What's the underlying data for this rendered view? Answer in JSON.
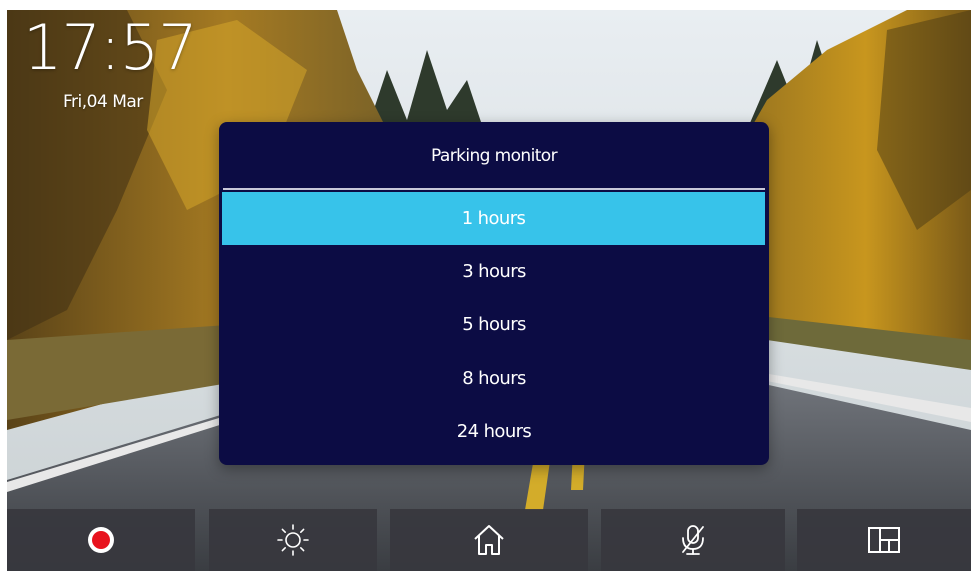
{
  "status": {
    "time": "17:57",
    "date": "Fri,04 Mar"
  },
  "dialog": {
    "title": "Parking monitor",
    "options": [
      {
        "label": "1 hours",
        "selected": true
      },
      {
        "label": "3 hours",
        "selected": false
      },
      {
        "label": "5 hours",
        "selected": false
      },
      {
        "label": "8 hours",
        "selected": false
      },
      {
        "label": "24 hours",
        "selected": false
      }
    ]
  },
  "dock": {
    "buttons": [
      {
        "icon": "record-icon"
      },
      {
        "icon": "brightness-icon"
      },
      {
        "icon": "home-icon"
      },
      {
        "icon": "mic-off-icon"
      },
      {
        "icon": "grid-icon"
      }
    ]
  },
  "colors": {
    "dialog_bg": "#0c0c44",
    "selected_bg": "#37c3ea",
    "record_red": "#e8121e",
    "dock_bg": "#37373e"
  }
}
